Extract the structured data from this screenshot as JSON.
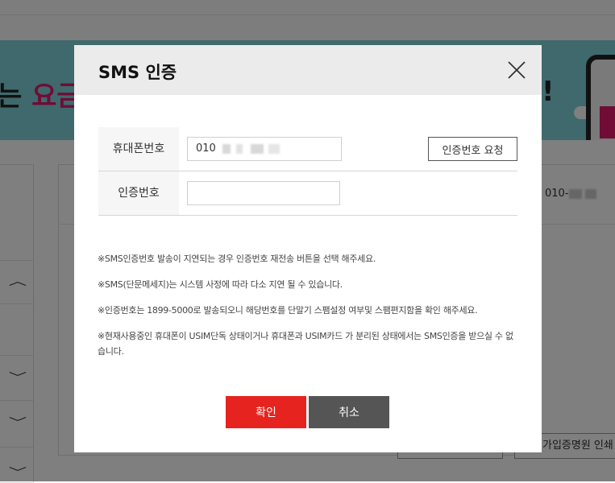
{
  "background": {
    "banner_text_prefix": "는 ",
    "banner_text_pink": "요금 ",
    "banner_text_suffix": "!",
    "phone_value_prefix": "010-",
    "button_label": "가입증명원 인쇄"
  },
  "modal": {
    "title": "SMS 인증",
    "close_icon": "close-icon",
    "phone_label": "휴대폰번호",
    "phone_value": "010",
    "request_button_label": "인증번호 요청",
    "code_label": "인증번호",
    "code_value": "",
    "notices": [
      "※SMS인증번호 발송이 지연되는 경우 인증번호 재전송 버튼을 선택 해주세요.",
      "※SMS(단문메세지)는 시스템 사정에 따라 다소 지연 될 수 있습니다.",
      "※인증번호는 1899-5000로 발송되오니 해당번호를 단말기 스팸설정 여부및 스팸편지함을 확인 해주세요.",
      "※현재사용중인 휴대폰이 USIM단독 상태이거나 휴대폰과 USIM카드 가 분리된 상태에서는 SMS인증을 받으실 수 없습니다."
    ],
    "confirm_label": "확인",
    "cancel_label": "취소"
  },
  "colors": {
    "confirm": "#e6231e",
    "cancel": "#555555",
    "banner": "#7fd2d8",
    "banner_accent": "#e0186b"
  }
}
